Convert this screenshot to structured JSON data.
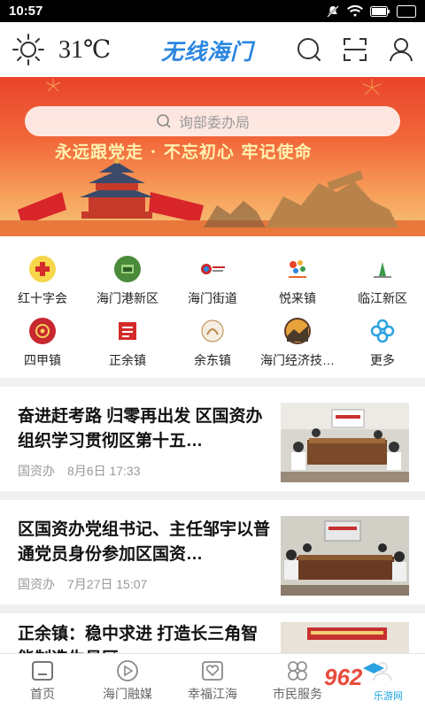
{
  "status": {
    "time": "10:57"
  },
  "header": {
    "temperature": "31℃",
    "logo": "无线海门"
  },
  "banner": {
    "search_placeholder": "询部委办局",
    "slogan": "永远跟党走 · 不忘初心 牢记使命"
  },
  "grid": [
    {
      "label": "红十字会",
      "icon": "red-cross-icon",
      "color": "#d52b2b"
    },
    {
      "label": "海门港新区",
      "icon": "port-district-icon",
      "color": "#4a8b3b"
    },
    {
      "label": "海门街道",
      "icon": "street-office-icon",
      "color": "#c8282f"
    },
    {
      "label": "悦来镇",
      "icon": "yuelai-town-icon",
      "color": "#e86a2b"
    },
    {
      "label": "临江新区",
      "icon": "linjiang-district-icon",
      "color": "#3b9a4a"
    },
    {
      "label": "四甲镇",
      "icon": "sijia-town-icon",
      "color": "#c8282f"
    },
    {
      "label": "正余镇",
      "icon": "zhengyu-town-icon",
      "color": "#d42a2a"
    },
    {
      "label": "余东镇",
      "icon": "yudong-town-icon",
      "color": "#b8864a"
    },
    {
      "label": "海门经济技…",
      "icon": "economic-zone-icon",
      "color": "#d9892b"
    },
    {
      "label": "更多",
      "icon": "more-icon",
      "color": "#2aa2e0"
    }
  ],
  "news": [
    {
      "title": "奋进赶考路 归零再出发 区国资办组织学习贯彻区第十五…",
      "source": "国资办",
      "time": "8月6日 17:33"
    },
    {
      "title": "区国资办党组书记、主任邹宇以普通党员身份参加区国资…",
      "source": "国资办",
      "time": "7月27日 15:07"
    },
    {
      "title": "正余镇：稳中求进 打造长三角智能制造生易区",
      "source": "",
      "time": ""
    }
  ],
  "nav": [
    {
      "label": "首页",
      "icon": "home-icon"
    },
    {
      "label": "海门融媒",
      "icon": "media-icon"
    },
    {
      "label": "幸福江海",
      "icon": "heart-icon"
    },
    {
      "label": "市民服务",
      "icon": "service-icon"
    },
    {
      "label": "",
      "icon": "user-icon"
    }
  ],
  "watermark": {
    "brand": "962",
    "sub": "乐游网"
  }
}
